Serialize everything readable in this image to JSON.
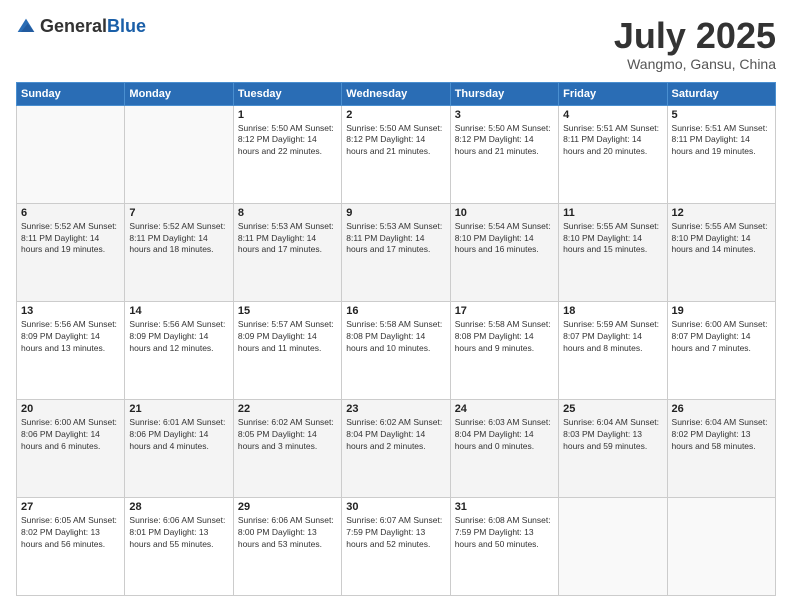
{
  "header": {
    "logo_general": "General",
    "logo_blue": "Blue",
    "title": "July 2025",
    "location": "Wangmo, Gansu, China"
  },
  "days_of_week": [
    "Sunday",
    "Monday",
    "Tuesday",
    "Wednesday",
    "Thursday",
    "Friday",
    "Saturday"
  ],
  "weeks": [
    [
      {
        "day": "",
        "info": ""
      },
      {
        "day": "",
        "info": ""
      },
      {
        "day": "1",
        "info": "Sunrise: 5:50 AM\nSunset: 8:12 PM\nDaylight: 14 hours and 22 minutes."
      },
      {
        "day": "2",
        "info": "Sunrise: 5:50 AM\nSunset: 8:12 PM\nDaylight: 14 hours and 21 minutes."
      },
      {
        "day": "3",
        "info": "Sunrise: 5:50 AM\nSunset: 8:12 PM\nDaylight: 14 hours and 21 minutes."
      },
      {
        "day": "4",
        "info": "Sunrise: 5:51 AM\nSunset: 8:11 PM\nDaylight: 14 hours and 20 minutes."
      },
      {
        "day": "5",
        "info": "Sunrise: 5:51 AM\nSunset: 8:11 PM\nDaylight: 14 hours and 19 minutes."
      }
    ],
    [
      {
        "day": "6",
        "info": "Sunrise: 5:52 AM\nSunset: 8:11 PM\nDaylight: 14 hours and 19 minutes."
      },
      {
        "day": "7",
        "info": "Sunrise: 5:52 AM\nSunset: 8:11 PM\nDaylight: 14 hours and 18 minutes."
      },
      {
        "day": "8",
        "info": "Sunrise: 5:53 AM\nSunset: 8:11 PM\nDaylight: 14 hours and 17 minutes."
      },
      {
        "day": "9",
        "info": "Sunrise: 5:53 AM\nSunset: 8:11 PM\nDaylight: 14 hours and 17 minutes."
      },
      {
        "day": "10",
        "info": "Sunrise: 5:54 AM\nSunset: 8:10 PM\nDaylight: 14 hours and 16 minutes."
      },
      {
        "day": "11",
        "info": "Sunrise: 5:55 AM\nSunset: 8:10 PM\nDaylight: 14 hours and 15 minutes."
      },
      {
        "day": "12",
        "info": "Sunrise: 5:55 AM\nSunset: 8:10 PM\nDaylight: 14 hours and 14 minutes."
      }
    ],
    [
      {
        "day": "13",
        "info": "Sunrise: 5:56 AM\nSunset: 8:09 PM\nDaylight: 14 hours and 13 minutes."
      },
      {
        "day": "14",
        "info": "Sunrise: 5:56 AM\nSunset: 8:09 PM\nDaylight: 14 hours and 12 minutes."
      },
      {
        "day": "15",
        "info": "Sunrise: 5:57 AM\nSunset: 8:09 PM\nDaylight: 14 hours and 11 minutes."
      },
      {
        "day": "16",
        "info": "Sunrise: 5:58 AM\nSunset: 8:08 PM\nDaylight: 14 hours and 10 minutes."
      },
      {
        "day": "17",
        "info": "Sunrise: 5:58 AM\nSunset: 8:08 PM\nDaylight: 14 hours and 9 minutes."
      },
      {
        "day": "18",
        "info": "Sunrise: 5:59 AM\nSunset: 8:07 PM\nDaylight: 14 hours and 8 minutes."
      },
      {
        "day": "19",
        "info": "Sunrise: 6:00 AM\nSunset: 8:07 PM\nDaylight: 14 hours and 7 minutes."
      }
    ],
    [
      {
        "day": "20",
        "info": "Sunrise: 6:00 AM\nSunset: 8:06 PM\nDaylight: 14 hours and 6 minutes."
      },
      {
        "day": "21",
        "info": "Sunrise: 6:01 AM\nSunset: 8:06 PM\nDaylight: 14 hours and 4 minutes."
      },
      {
        "day": "22",
        "info": "Sunrise: 6:02 AM\nSunset: 8:05 PM\nDaylight: 14 hours and 3 minutes."
      },
      {
        "day": "23",
        "info": "Sunrise: 6:02 AM\nSunset: 8:04 PM\nDaylight: 14 hours and 2 minutes."
      },
      {
        "day": "24",
        "info": "Sunrise: 6:03 AM\nSunset: 8:04 PM\nDaylight: 14 hours and 0 minutes."
      },
      {
        "day": "25",
        "info": "Sunrise: 6:04 AM\nSunset: 8:03 PM\nDaylight: 13 hours and 59 minutes."
      },
      {
        "day": "26",
        "info": "Sunrise: 6:04 AM\nSunset: 8:02 PM\nDaylight: 13 hours and 58 minutes."
      }
    ],
    [
      {
        "day": "27",
        "info": "Sunrise: 6:05 AM\nSunset: 8:02 PM\nDaylight: 13 hours and 56 minutes."
      },
      {
        "day": "28",
        "info": "Sunrise: 6:06 AM\nSunset: 8:01 PM\nDaylight: 13 hours and 55 minutes."
      },
      {
        "day": "29",
        "info": "Sunrise: 6:06 AM\nSunset: 8:00 PM\nDaylight: 13 hours and 53 minutes."
      },
      {
        "day": "30",
        "info": "Sunrise: 6:07 AM\nSunset: 7:59 PM\nDaylight: 13 hours and 52 minutes."
      },
      {
        "day": "31",
        "info": "Sunrise: 6:08 AM\nSunset: 7:59 PM\nDaylight: 13 hours and 50 minutes."
      },
      {
        "day": "",
        "info": ""
      },
      {
        "day": "",
        "info": ""
      }
    ]
  ]
}
